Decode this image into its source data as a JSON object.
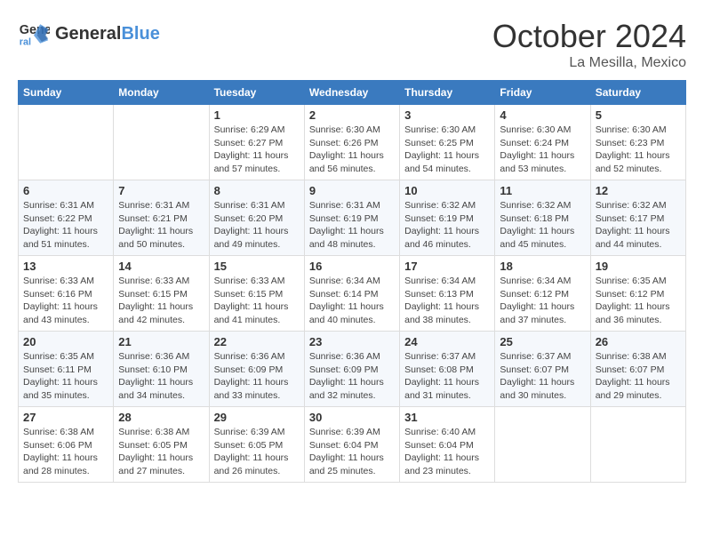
{
  "logo": {
    "line1": "General",
    "line2": "Blue"
  },
  "header": {
    "month": "October 2024",
    "location": "La Mesilla, Mexico"
  },
  "days_of_week": [
    "Sunday",
    "Monday",
    "Tuesday",
    "Wednesday",
    "Thursday",
    "Friday",
    "Saturday"
  ],
  "weeks": [
    [
      {
        "day": "",
        "content": ""
      },
      {
        "day": "",
        "content": ""
      },
      {
        "day": "1",
        "content": "Sunrise: 6:29 AM\nSunset: 6:27 PM\nDaylight: 11 hours\nand 57 minutes."
      },
      {
        "day": "2",
        "content": "Sunrise: 6:30 AM\nSunset: 6:26 PM\nDaylight: 11 hours\nand 56 minutes."
      },
      {
        "day": "3",
        "content": "Sunrise: 6:30 AM\nSunset: 6:25 PM\nDaylight: 11 hours\nand 54 minutes."
      },
      {
        "day": "4",
        "content": "Sunrise: 6:30 AM\nSunset: 6:24 PM\nDaylight: 11 hours\nand 53 minutes."
      },
      {
        "day": "5",
        "content": "Sunrise: 6:30 AM\nSunset: 6:23 PM\nDaylight: 11 hours\nand 52 minutes."
      }
    ],
    [
      {
        "day": "6",
        "content": "Sunrise: 6:31 AM\nSunset: 6:22 PM\nDaylight: 11 hours\nand 51 minutes."
      },
      {
        "day": "7",
        "content": "Sunrise: 6:31 AM\nSunset: 6:21 PM\nDaylight: 11 hours\nand 50 minutes."
      },
      {
        "day": "8",
        "content": "Sunrise: 6:31 AM\nSunset: 6:20 PM\nDaylight: 11 hours\nand 49 minutes."
      },
      {
        "day": "9",
        "content": "Sunrise: 6:31 AM\nSunset: 6:19 PM\nDaylight: 11 hours\nand 48 minutes."
      },
      {
        "day": "10",
        "content": "Sunrise: 6:32 AM\nSunset: 6:19 PM\nDaylight: 11 hours\nand 46 minutes."
      },
      {
        "day": "11",
        "content": "Sunrise: 6:32 AM\nSunset: 6:18 PM\nDaylight: 11 hours\nand 45 minutes."
      },
      {
        "day": "12",
        "content": "Sunrise: 6:32 AM\nSunset: 6:17 PM\nDaylight: 11 hours\nand 44 minutes."
      }
    ],
    [
      {
        "day": "13",
        "content": "Sunrise: 6:33 AM\nSunset: 6:16 PM\nDaylight: 11 hours\nand 43 minutes."
      },
      {
        "day": "14",
        "content": "Sunrise: 6:33 AM\nSunset: 6:15 PM\nDaylight: 11 hours\nand 42 minutes."
      },
      {
        "day": "15",
        "content": "Sunrise: 6:33 AM\nSunset: 6:15 PM\nDaylight: 11 hours\nand 41 minutes."
      },
      {
        "day": "16",
        "content": "Sunrise: 6:34 AM\nSunset: 6:14 PM\nDaylight: 11 hours\nand 40 minutes."
      },
      {
        "day": "17",
        "content": "Sunrise: 6:34 AM\nSunset: 6:13 PM\nDaylight: 11 hours\nand 38 minutes."
      },
      {
        "day": "18",
        "content": "Sunrise: 6:34 AM\nSunset: 6:12 PM\nDaylight: 11 hours\nand 37 minutes."
      },
      {
        "day": "19",
        "content": "Sunrise: 6:35 AM\nSunset: 6:12 PM\nDaylight: 11 hours\nand 36 minutes."
      }
    ],
    [
      {
        "day": "20",
        "content": "Sunrise: 6:35 AM\nSunset: 6:11 PM\nDaylight: 11 hours\nand 35 minutes."
      },
      {
        "day": "21",
        "content": "Sunrise: 6:36 AM\nSunset: 6:10 PM\nDaylight: 11 hours\nand 34 minutes."
      },
      {
        "day": "22",
        "content": "Sunrise: 6:36 AM\nSunset: 6:09 PM\nDaylight: 11 hours\nand 33 minutes."
      },
      {
        "day": "23",
        "content": "Sunrise: 6:36 AM\nSunset: 6:09 PM\nDaylight: 11 hours\nand 32 minutes."
      },
      {
        "day": "24",
        "content": "Sunrise: 6:37 AM\nSunset: 6:08 PM\nDaylight: 11 hours\nand 31 minutes."
      },
      {
        "day": "25",
        "content": "Sunrise: 6:37 AM\nSunset: 6:07 PM\nDaylight: 11 hours\nand 30 minutes."
      },
      {
        "day": "26",
        "content": "Sunrise: 6:38 AM\nSunset: 6:07 PM\nDaylight: 11 hours\nand 29 minutes."
      }
    ],
    [
      {
        "day": "27",
        "content": "Sunrise: 6:38 AM\nSunset: 6:06 PM\nDaylight: 11 hours\nand 28 minutes."
      },
      {
        "day": "28",
        "content": "Sunrise: 6:38 AM\nSunset: 6:05 PM\nDaylight: 11 hours\nand 27 minutes."
      },
      {
        "day": "29",
        "content": "Sunrise: 6:39 AM\nSunset: 6:05 PM\nDaylight: 11 hours\nand 26 minutes."
      },
      {
        "day": "30",
        "content": "Sunrise: 6:39 AM\nSunset: 6:04 PM\nDaylight: 11 hours\nand 25 minutes."
      },
      {
        "day": "31",
        "content": "Sunrise: 6:40 AM\nSunset: 6:04 PM\nDaylight: 11 hours\nand 23 minutes."
      },
      {
        "day": "",
        "content": ""
      },
      {
        "day": "",
        "content": ""
      }
    ]
  ]
}
